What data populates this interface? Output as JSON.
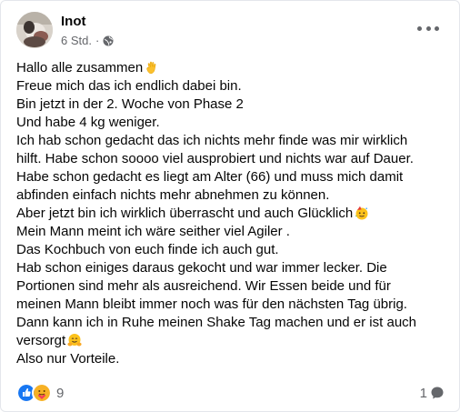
{
  "post": {
    "author": "Inot",
    "time": "6 Std.",
    "separator": "·",
    "privacy_icon": "globe-icon",
    "menu_icon": "more-options-icon",
    "lines": [
      "Hallo alle zusammen",
      "Freue mich das ich endlich dabei bin.",
      "Bin jetzt in der 2. Woche von Phase 2",
      "Und habe 4 kg weniger.",
      "Ich hab schon gedacht das ich nichts mehr finde was mir wirklich",
      "hilft. Habe schon soooo viel ausprobiert und nichts war auf Dauer.",
      "Habe schon gedacht es liegt am Alter (66) und muss mich damit",
      "abfinden einfach nichts mehr abnehmen zu können.",
      "Aber jetzt bin ich wirklich überrascht und auch Glücklich",
      "Mein Mann meint ich wäre seither viel Agiler .",
      "Das Kochbuch von euch finde ich auch gut.",
      "Hab schon einiges daraus gekocht und war immer lecker. Die",
      "Portionen sind mehr als ausreichend. Wir Essen beide und für",
      "meinen Mann bleibt immer noch was für den nächsten Tag übrig.",
      "Dann kann ich in Ruhe meinen Shake Tag machen und er ist auch",
      "versorgt",
      "Also nur Vorteile."
    ],
    "emojis": {
      "line_0": "waving-hand-emoji",
      "line_8": "partying-face-emoji",
      "line_15": "hugging-face-emoji"
    }
  },
  "footer": {
    "reaction_icons": [
      "like-icon",
      "care-icon"
    ],
    "reaction_count": "9",
    "comment_count": "1",
    "comment_icon": "comment-bubble-icon"
  },
  "colors": {
    "text": "#050505",
    "secondary": "#65676b",
    "like_blue": "#1877f2",
    "care_yellow": "#f7b125"
  }
}
